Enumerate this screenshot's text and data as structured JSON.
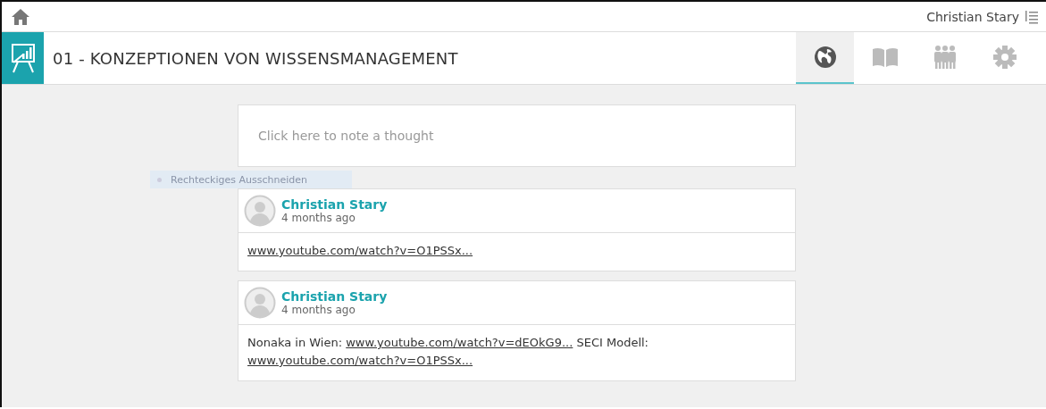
{
  "top_bar": {
    "user_name": "Christian Stary"
  },
  "header": {
    "title": "01 - KONZEPTIONEN VON WISSENSMANAGEMENT"
  },
  "tabs": [
    {
      "kind": "globe",
      "selected": true
    },
    {
      "kind": "book",
      "selected": false
    },
    {
      "kind": "people",
      "selected": false
    },
    {
      "kind": "gear",
      "selected": false
    }
  ],
  "note_input": {
    "placeholder": "Click here to note a thought"
  },
  "overlay_hint": "Rechteckiges Ausschneiden",
  "posts": [
    {
      "author": "Christian Stary",
      "time": "4 months ago",
      "body": [
        {
          "kind": "link",
          "text": "www.youtube.com/watch?v=O1PSSx..."
        }
      ]
    },
    {
      "author": "Christian Stary",
      "time": "4 months ago",
      "body": [
        {
          "kind": "text",
          "text": "Nonaka in Wien: "
        },
        {
          "kind": "link",
          "text": "www.youtube.com/watch?v=dEOkG9..."
        },
        {
          "kind": "text",
          "text": " SECI Modell: "
        },
        {
          "kind": "link",
          "text": "www.youtube.com/watch?v=O1PSSx..."
        }
      ]
    }
  ]
}
